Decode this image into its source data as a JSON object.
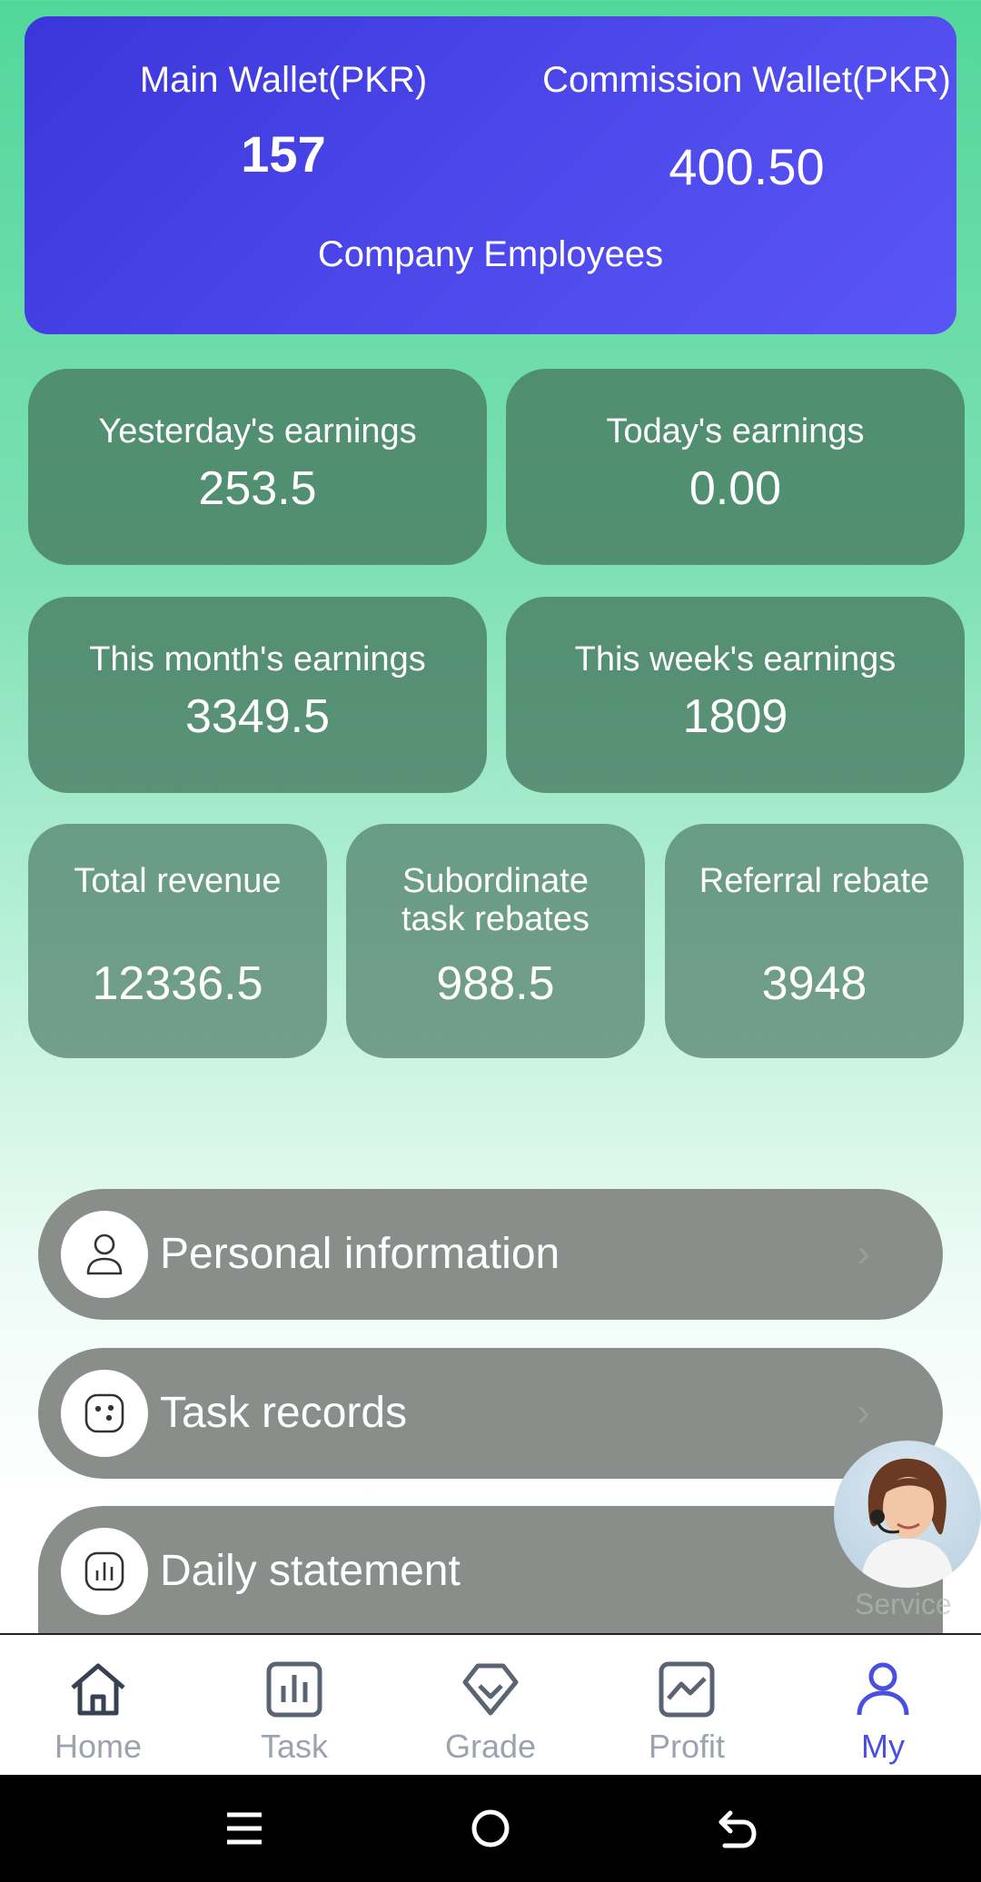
{
  "wallet": {
    "main_label": "Main Wallet(PKR)",
    "main_value": "157",
    "commission_label": "Commission Wallet(PKR)",
    "commission_value": "400.50",
    "level": "Company Employees"
  },
  "stats": [
    {
      "label": "Yesterday's earnings",
      "value": "253.5"
    },
    {
      "label": "Today's earnings",
      "value": "0.00"
    },
    {
      "label": "This month's earnings",
      "value": "3349.5"
    },
    {
      "label": "This week's earnings",
      "value": "1809"
    },
    {
      "label": "Total revenue",
      "value": "12336.5"
    },
    {
      "label": "Subordinate task rebates",
      "value": "988.5"
    },
    {
      "label": "Referral rebate",
      "value": "3948"
    }
  ],
  "menu": [
    {
      "label": "Personal information",
      "icon": "user-icon"
    },
    {
      "label": "Task records",
      "icon": "task-records-icon"
    },
    {
      "label": "Daily statement",
      "icon": "chart-icon"
    }
  ],
  "service": {
    "label": "Service"
  },
  "tabs": [
    {
      "label": "Home",
      "icon": "home-icon"
    },
    {
      "label": "Task",
      "icon": "task-icon"
    },
    {
      "label": "Grade",
      "icon": "grade-icon"
    },
    {
      "label": "Profit",
      "icon": "profit-icon"
    },
    {
      "label": "My",
      "icon": "user-icon",
      "active": true
    }
  ],
  "colors": {
    "accent": "#4b4fe0",
    "wallet_card": "#4c47ea",
    "stat_card": "#5a8a70",
    "menu_pill": "#8a8e8b"
  }
}
